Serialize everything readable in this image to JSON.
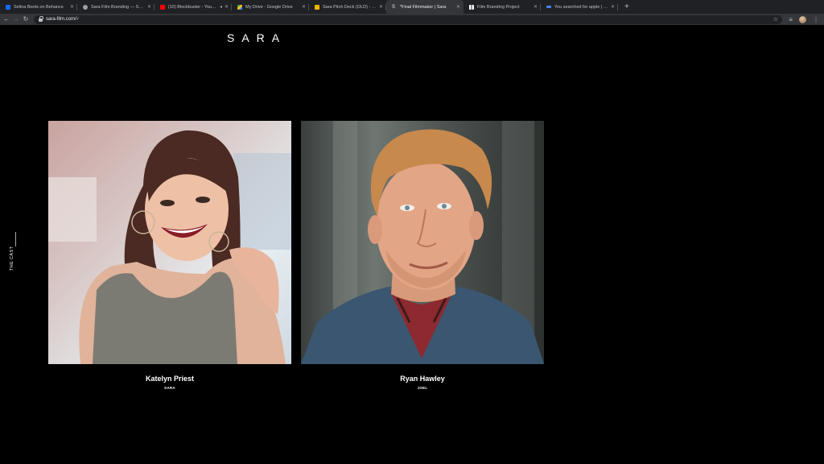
{
  "browser": {
    "tabs": [
      {
        "title": "Selina Boots on Behance",
        "favicon_color": "#1769ff"
      },
      {
        "title": "Sara Film Branding — Selina I…",
        "favicon_color": "#9aa0a6"
      },
      {
        "title": "(10) Blockbuster - YouTube",
        "favicon_color": "#ff0000",
        "extra": "◂"
      },
      {
        "title": "My Drive - Google Drive",
        "favicon_color": "#34a853"
      },
      {
        "title": "Sara Pitch Deck (OLD) - Goog…",
        "favicon_color": "#f4b400"
      },
      {
        "title": "*Final Filmmaker | Sara",
        "favicon_color": "#e8eaed",
        "active": true
      },
      {
        "title": "Film Branding Project",
        "favicon_color": "#ffffff"
      },
      {
        "title": "You searched for apple | Pag…",
        "favicon_color": "#4285f4"
      }
    ],
    "new_tab": "+",
    "url": "sara-film.com/",
    "url_hash": "#"
  },
  "page": {
    "logo": "SARA",
    "section_label": "THE CAST",
    "cast": [
      {
        "name": "Katelyn Priest",
        "role": "SARA"
      },
      {
        "name": "Ryan Hawley",
        "role": "JOEL"
      }
    ]
  }
}
